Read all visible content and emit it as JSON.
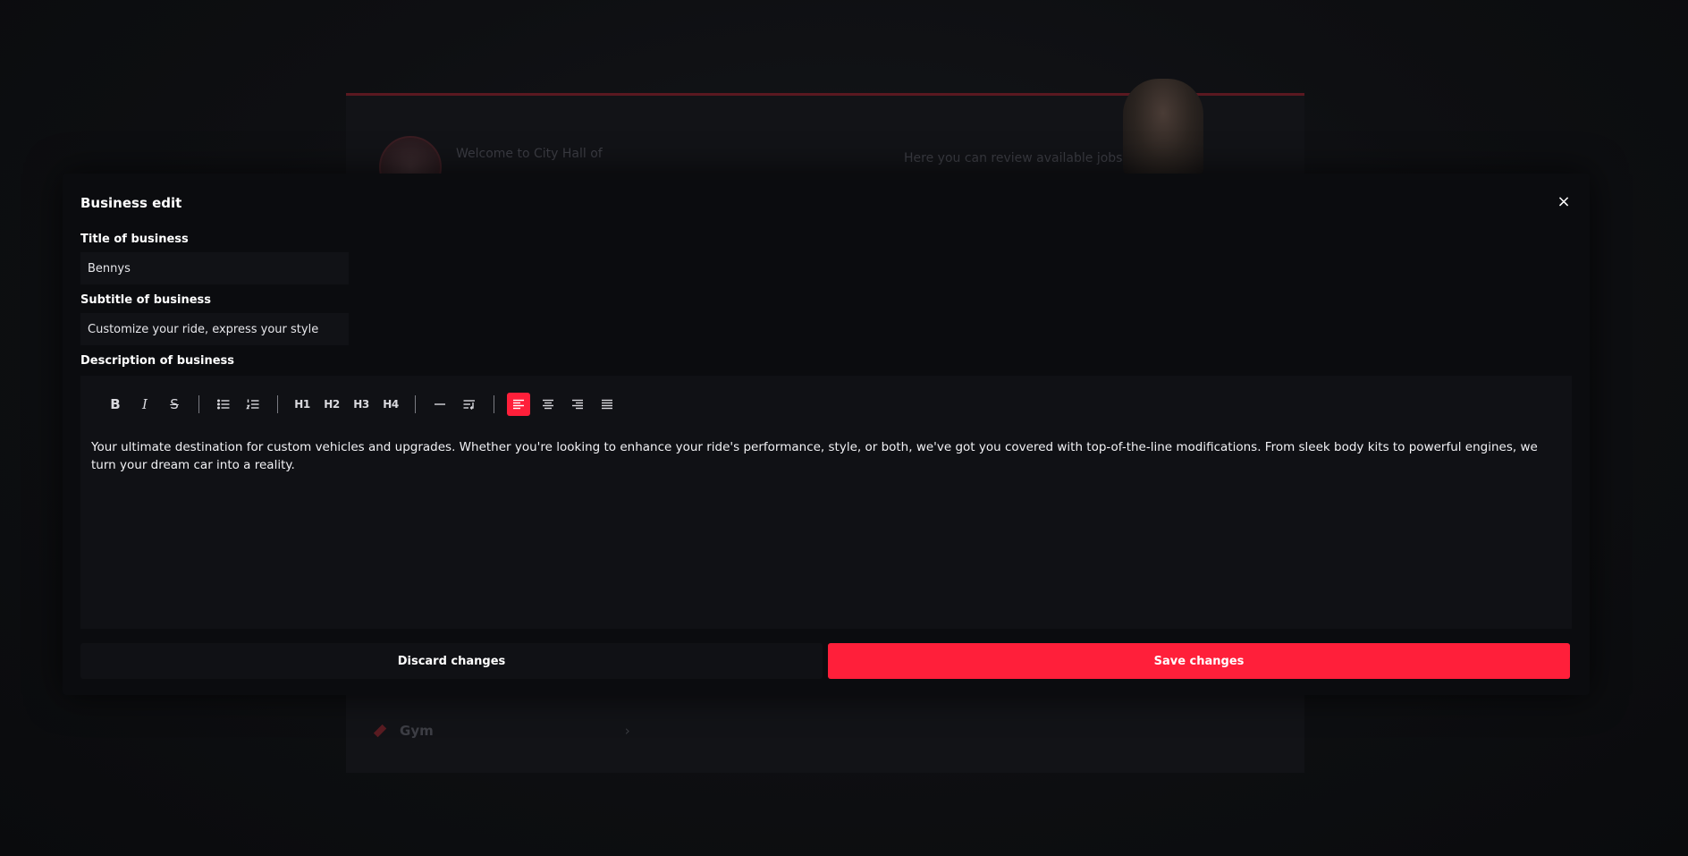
{
  "background": {
    "welcome_text": "Welcome to City Hall of",
    "review_text": "Here you can review available jobs",
    "gym_label": "Gym",
    "gym_chevron": "›"
  },
  "modal": {
    "title": "Business edit",
    "close_icon": "×",
    "title_field": {
      "label": "Title of business",
      "value": "Bennys"
    },
    "subtitle_field": {
      "label": "Subtitle of business",
      "value": "Customize your ride, express your style"
    },
    "description_field": {
      "label": "Description of business",
      "content": "Your ultimate destination for custom vehicles and upgrades. Whether you're looking to enhance your ride's performance, style, or both, we've got you covered with top-of-the-line modifications. From sleek body kits to powerful engines, we turn your dream car into a reality."
    },
    "toolbar": {
      "bold": "B",
      "italic": "I",
      "strike": "S",
      "h1": "H1",
      "h2": "H2",
      "h3": "H3",
      "h4": "H4"
    },
    "discard_label": "Discard changes",
    "save_label": "Save changes"
  },
  "colors": {
    "accent": "#ff1f3a",
    "modal_bg": "#0b0c0f",
    "input_bg": "#111216"
  }
}
